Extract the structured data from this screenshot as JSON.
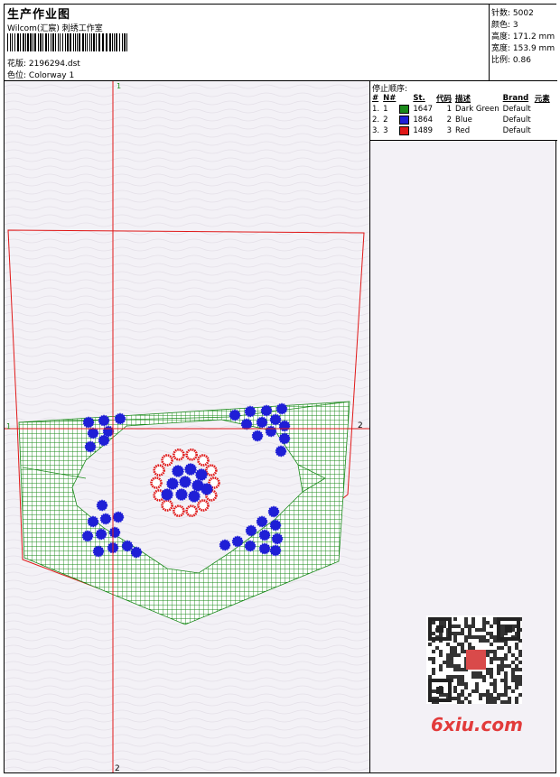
{
  "header": {
    "title": "生产作业图",
    "company": "Wilcom(汇宸) 刺绣工作室",
    "design_file_label": "花版:",
    "design_file": "2196294.dst",
    "colorway_label": "色位:",
    "colorway": "Colorway 1"
  },
  "stats": {
    "stitches_label": "针数:",
    "stitches": "5002",
    "colors_label": "颜色:",
    "colors": "3",
    "height_label": "高度:",
    "height": "171.2 mm",
    "width_label": "宽度:",
    "width": "153.9 mm",
    "scale_label": "比例:",
    "scale": "0.86"
  },
  "stop_sequence": {
    "title": "停止顺序:",
    "headers": [
      "#",
      "N#",
      "",
      "St.",
      "代码",
      "描述",
      "Brand",
      "元素"
    ],
    "rows": [
      {
        "idx": "1.",
        "n": "1",
        "color": "#1a8a1a",
        "stitches": "1647",
        "code": "1",
        "desc": "Dark Green",
        "brand": "Default"
      },
      {
        "idx": "2.",
        "n": "2",
        "color": "#1f1fd6",
        "stitches": "1864",
        "code": "2",
        "desc": "Blue",
        "brand": "Default"
      },
      {
        "idx": "3.",
        "n": "3",
        "color": "#e01818",
        "stitches": "1489",
        "code": "3",
        "desc": "Red",
        "brand": "Default"
      }
    ]
  },
  "guides": {
    "v_top": "1",
    "v_bottom": "2",
    "h_left": "1",
    "h_right": "2"
  },
  "watermark": {
    "site": "6xiu.com"
  }
}
